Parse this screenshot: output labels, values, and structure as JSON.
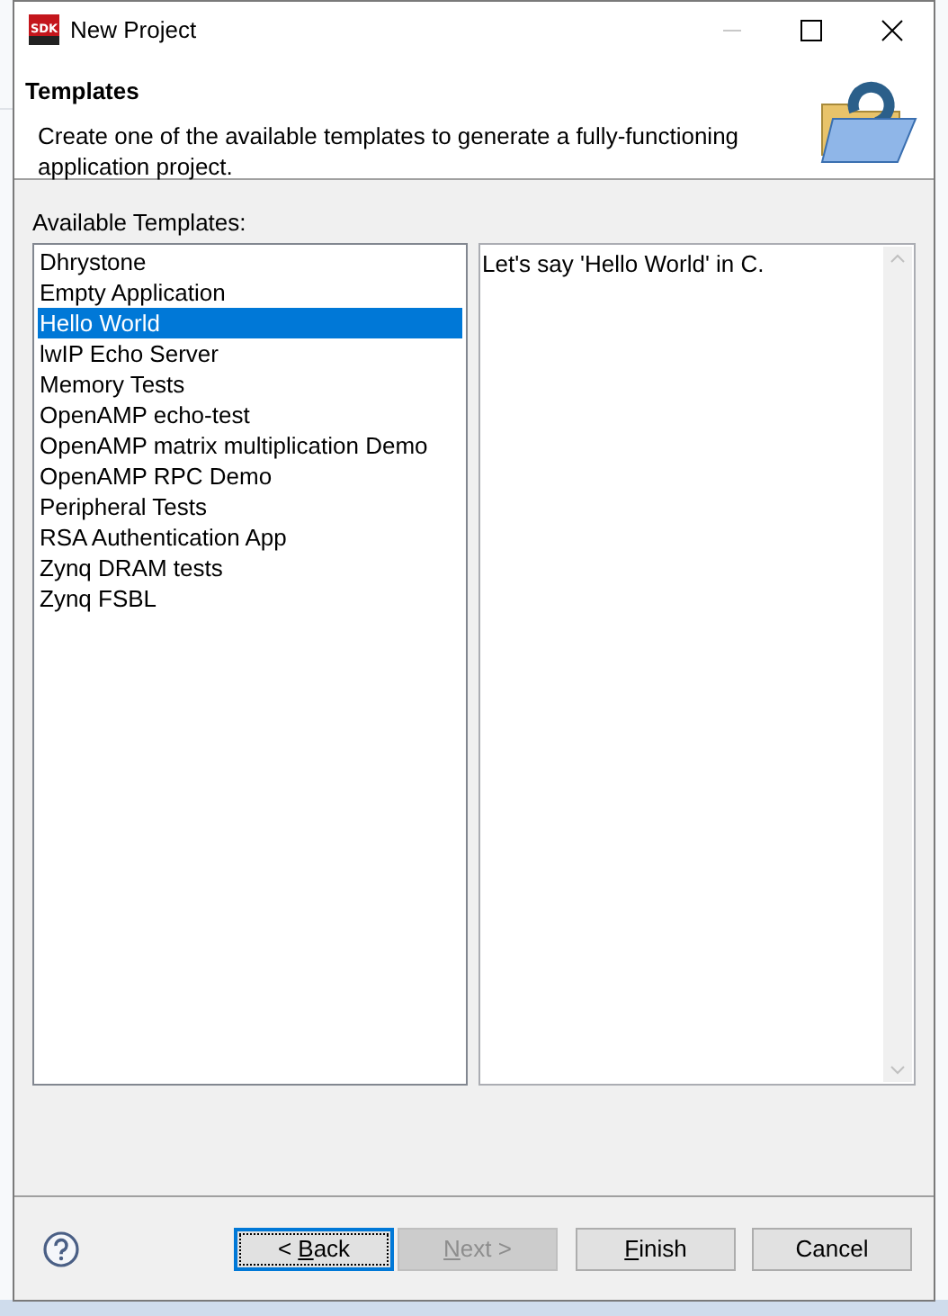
{
  "window": {
    "title": "New Project",
    "logo_text": "SDK"
  },
  "header": {
    "title": "Templates",
    "description": "Create one of the available templates to generate a fully-functioning application project."
  },
  "templates_label": "Available Templates:",
  "templates": [
    {
      "label": "Dhrystone",
      "selected": false
    },
    {
      "label": "Empty Application",
      "selected": false
    },
    {
      "label": "Hello World",
      "selected": true
    },
    {
      "label": "lwIP Echo Server",
      "selected": false
    },
    {
      "label": "Memory Tests",
      "selected": false
    },
    {
      "label": "OpenAMP echo-test",
      "selected": false
    },
    {
      "label": "OpenAMP matrix multiplication Demo",
      "selected": false
    },
    {
      "label": "OpenAMP RPC Demo",
      "selected": false
    },
    {
      "label": "Peripheral Tests",
      "selected": false
    },
    {
      "label": "RSA Authentication App",
      "selected": false
    },
    {
      "label": "Zynq DRAM tests",
      "selected": false
    },
    {
      "label": "Zynq FSBL",
      "selected": false
    }
  ],
  "description_text": "Let's say 'Hello World' in C.",
  "buttons": [
    {
      "before": "< ",
      "key": "B",
      "after": "ack",
      "focused": true,
      "disabled": false
    },
    {
      "key": "N",
      "after": "ext >",
      "focused": false,
      "disabled": true
    },
    {
      "key": "F",
      "after": "inish",
      "focused": false,
      "disabled": false
    },
    {
      "before": "Cancel",
      "focused": false,
      "disabled": false
    }
  ]
}
